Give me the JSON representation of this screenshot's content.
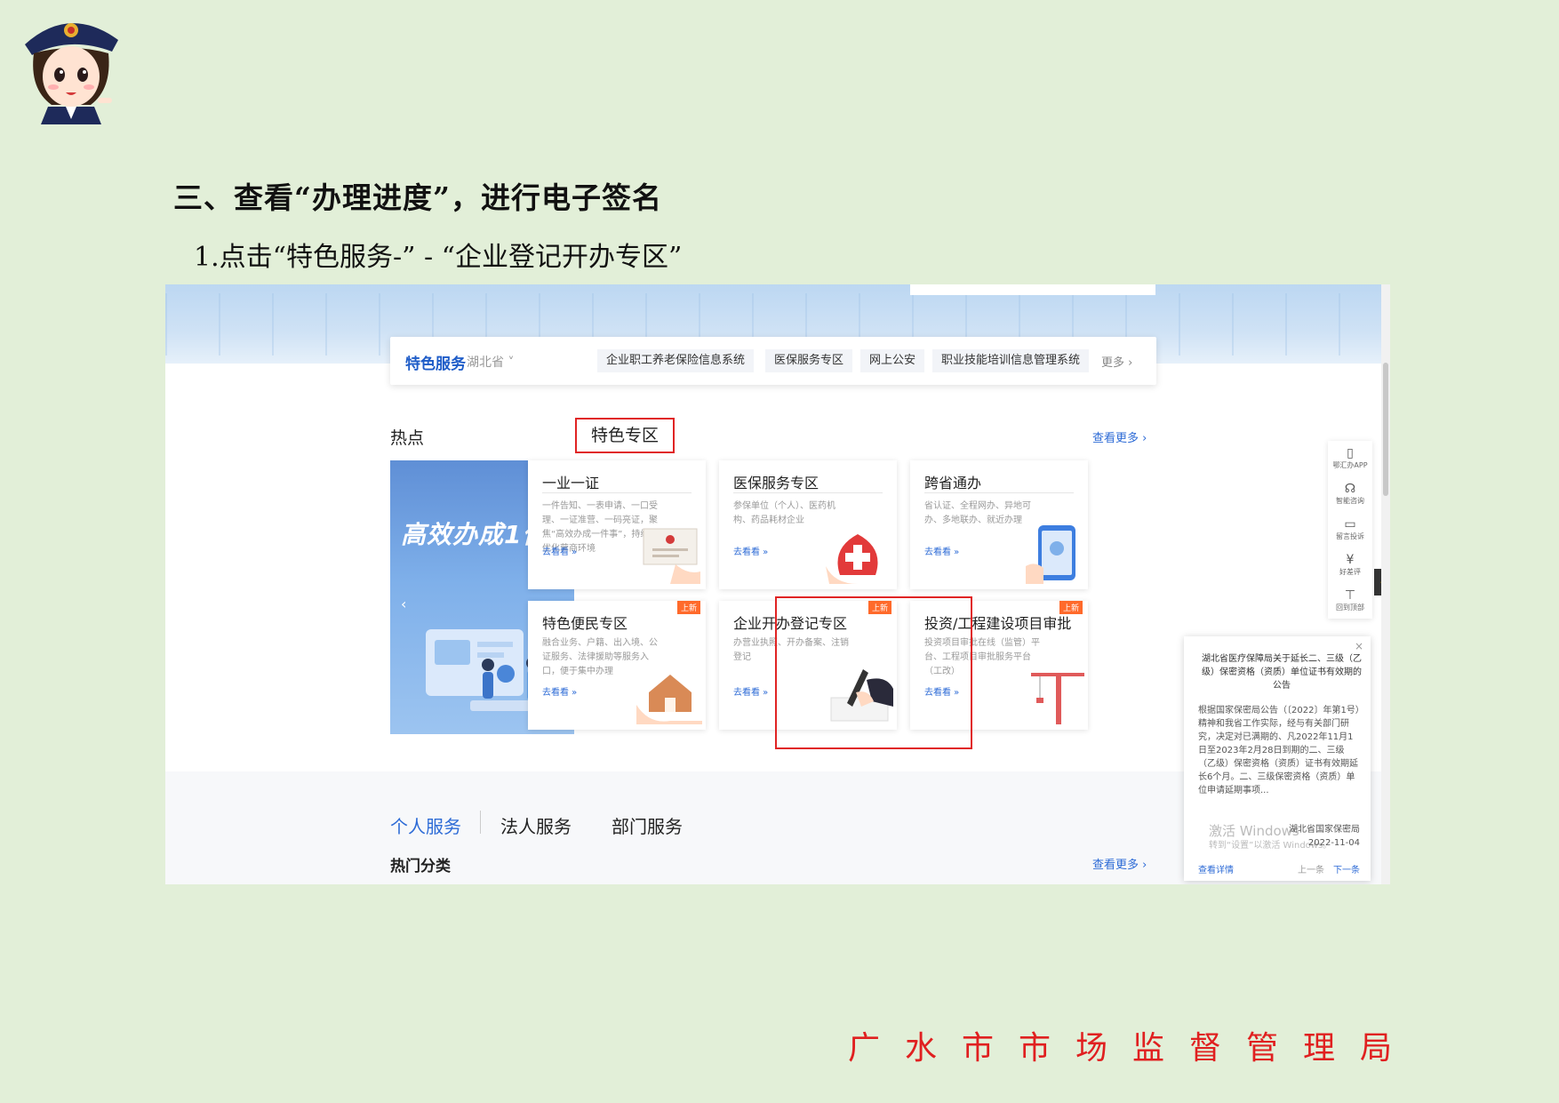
{
  "heading": "三、查看“办理进度”，进行电子签名",
  "subheading": "1.点击“特色服务-” - “企业登记开办专区”",
  "footer_org": "广水市市场监督管理局",
  "screenshot": {
    "service_bar": {
      "title": "特色服务",
      "province": "湖北省",
      "tags": [
        "企业职工养老保险信息系统",
        "医保服务专区",
        "网上公安",
        "职业技能培训信息管理系统"
      ],
      "more": "更多 ›"
    },
    "section_hot": "热点",
    "section_special": "特色专区",
    "see_more": "查看更多 ›",
    "hero": {
      "slogan": "高效办成1件事"
    },
    "cards": [
      {
        "title": "一业一证",
        "desc": "一件告知、一表申请、一口受理、一证准营、一码亮证，聚焦“高效办成一件事”，持续优化营商环境",
        "go": "去看看 »",
        "badge": ""
      },
      {
        "title": "医保服务专区",
        "desc": "参保单位（个人）、医药机构、药品耗材企业",
        "go": "去看看 »",
        "badge": ""
      },
      {
        "title": "跨省通办",
        "desc": "省认证、全程网办、异地可办、多地联办、就近办理",
        "go": "去看看 »",
        "badge": ""
      },
      {
        "title": "特色便民专区",
        "desc": "融合业务、户籍、出入境、公证服务、法律援助等服务入口，便于集中办理",
        "go": "去看看 »",
        "badge": "上新"
      },
      {
        "title": "企业开办登记专区",
        "desc": "办营业执照、开办备案、注销登记",
        "go": "去看看 »",
        "badge": "上新"
      },
      {
        "title": "投资/工程建设项目审批",
        "desc": "投资项目审批在线（监管）平台、工程项目审批服务平台（工改）",
        "go": "去看看 »",
        "badge": "上新"
      }
    ],
    "tabs": [
      "个人服务",
      "法人服务",
      "部门服务"
    ],
    "hot_category": "热门分类",
    "see_more2": "查看更多 ›",
    "side_tools": [
      {
        "icon": "phone-icon",
        "label": "鄂汇办APP"
      },
      {
        "icon": "headset-icon",
        "label": "智能咨询"
      },
      {
        "icon": "message-icon",
        "label": "留言投诉"
      },
      {
        "icon": "yen-icon",
        "label": "好差评"
      },
      {
        "icon": "top-icon",
        "label": "回到顶部"
      }
    ],
    "notice": {
      "close": "×",
      "title": "湖北省医疗保障局关于延长二、三级（乙级）保密资格（资质）单位证书有效期的公告",
      "body": "根据国家保密局公告（〔2022〕年第1号）精神和我省工作实际，经与有关部门研究，决定对已满期的、凡2022年11月1日至2023年2月28日到期的二、三级（乙级）保密资格（资质）证书有效期延长6个月。二、三级保密资格（资质）单位申请延期事项...",
      "watermark": "激活 Windows",
      "watermark_sub": "转到“设置”以激活 Windows。",
      "org": "湖北省国家保密局",
      "date": "2022-11-04",
      "detail": "查看详情",
      "prev": "上一条",
      "next": "下一条"
    }
  },
  "colors": {
    "accent": "#2d6bd6",
    "highlight": "#e02424",
    "badge": "#ff6a2b",
    "page_bg": "#e2efd8"
  }
}
